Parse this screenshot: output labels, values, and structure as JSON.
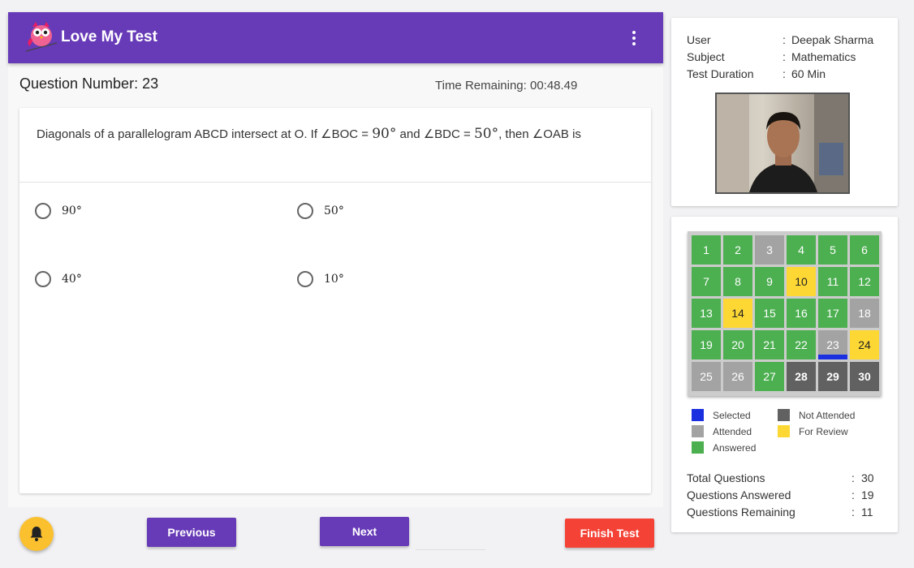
{
  "app": {
    "title": "Love My Test"
  },
  "question": {
    "number_label": "Question Number: 23",
    "time_label": "Time Remaining: 00:48.49",
    "text_before": "Diagonals of a parallelogram ABCD intersect at O. If ∠BOC = ",
    "math_1": "90°",
    "text_mid": " and ∠BDC = ",
    "math_2": "50°",
    "text_after": ", then ∠OAB is",
    "options": [
      "90°",
      "50°",
      "40°",
      "10°"
    ]
  },
  "buttons": {
    "previous": "Previous",
    "next": "Next",
    "finish": "Finish Test"
  },
  "user_info": [
    {
      "key": "User",
      "value": "Deepak Sharma"
    },
    {
      "key": "Subject",
      "value": "Mathematics"
    },
    {
      "key": "Test Duration",
      "value": "60 Min"
    }
  ],
  "colon": ":",
  "status_colors": {
    "answered": "#4caf50",
    "attended": "#a3a3a3",
    "not_attended": "#616161",
    "review": "#fdd835",
    "selected": "#1a2fe0"
  },
  "questions": [
    {
      "n": "1",
      "status": "answered"
    },
    {
      "n": "2",
      "status": "answered"
    },
    {
      "n": "3",
      "status": "attended"
    },
    {
      "n": "4",
      "status": "answered"
    },
    {
      "n": "5",
      "status": "answered"
    },
    {
      "n": "6",
      "status": "answered"
    },
    {
      "n": "7",
      "status": "answered"
    },
    {
      "n": "8",
      "status": "answered"
    },
    {
      "n": "9",
      "status": "answered"
    },
    {
      "n": "10",
      "status": "review"
    },
    {
      "n": "11",
      "status": "answered"
    },
    {
      "n": "12",
      "status": "answered"
    },
    {
      "n": "13",
      "status": "answered"
    },
    {
      "n": "14",
      "status": "review"
    },
    {
      "n": "15",
      "status": "answered"
    },
    {
      "n": "16",
      "status": "answered"
    },
    {
      "n": "17",
      "status": "answered"
    },
    {
      "n": "18",
      "status": "attended"
    },
    {
      "n": "19",
      "status": "answered"
    },
    {
      "n": "20",
      "status": "answered"
    },
    {
      "n": "21",
      "status": "answered"
    },
    {
      "n": "22",
      "status": "answered"
    },
    {
      "n": "23",
      "status": "attended",
      "selected": true
    },
    {
      "n": "24",
      "status": "review"
    },
    {
      "n": "25",
      "status": "attended"
    },
    {
      "n": "26",
      "status": "attended"
    },
    {
      "n": "27",
      "status": "answered"
    },
    {
      "n": "28",
      "status": "not_attended"
    },
    {
      "n": "29",
      "status": "not_attended"
    },
    {
      "n": "30",
      "status": "not_attended"
    }
  ],
  "legend": {
    "selected": "Selected",
    "not_attended": "Not Attended",
    "attended": "Attended",
    "for_review": "For Review",
    "answered": "Answered"
  },
  "stats": [
    {
      "key": "Total Questions",
      "value": "30"
    },
    {
      "key": "Questions Answered",
      "value": "19"
    },
    {
      "key": "Questions Remaining",
      "value": "11"
    }
  ]
}
